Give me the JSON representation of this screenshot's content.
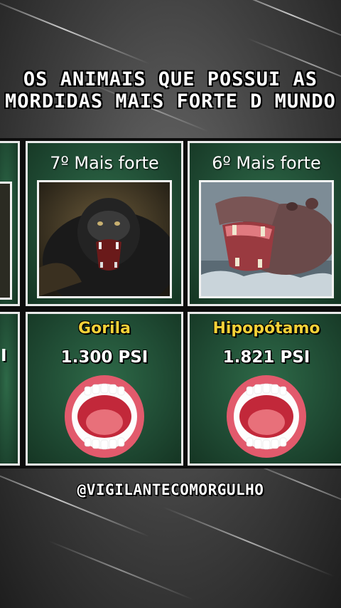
{
  "title": {
    "line1": "OS ANIMAIS QUE POSSUI AS",
    "line2": "MORDIDAS MAIS FORTE D MUNDO"
  },
  "cards": [
    {
      "rank": "7º Mais forte",
      "animal": "Gorila",
      "force": "1.300 PSI",
      "image": "gorilla-roaring"
    },
    {
      "rank": "6º Mais forte",
      "animal": "Hipopótamo",
      "force": "1.821 PSI",
      "image": "hippo-mouth-open"
    }
  ],
  "partial_left": {
    "force_fragment": "I"
  },
  "handle": "@VIGILANTECOMORGULHO",
  "colors": {
    "card_bg": "#1f4a33",
    "name": "#f2d138",
    "border": "#e9e9e9"
  }
}
